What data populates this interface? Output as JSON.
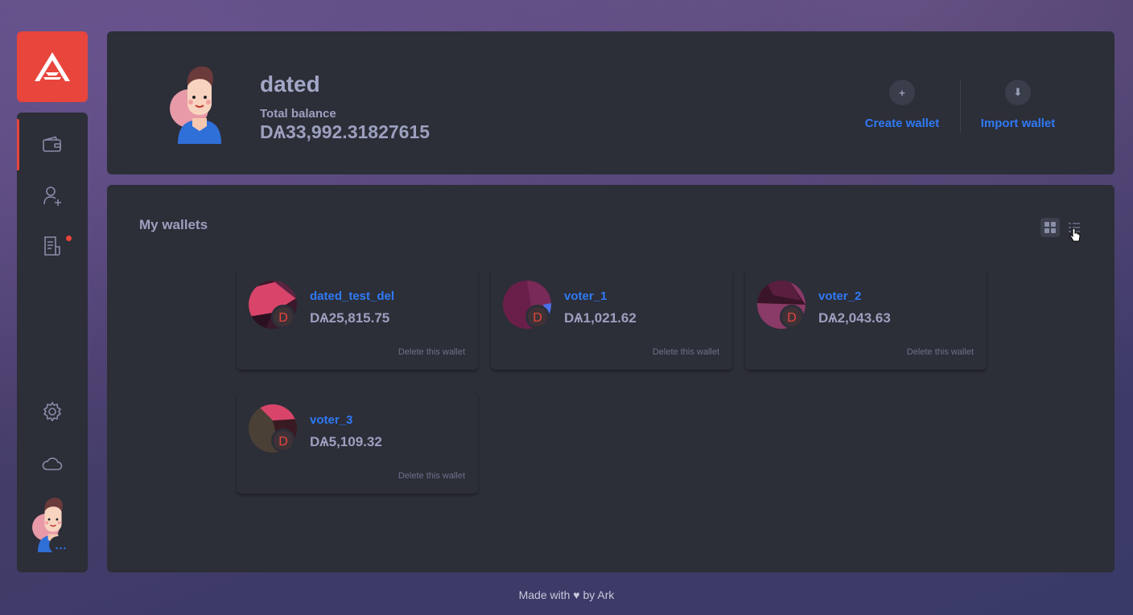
{
  "colors": {
    "accent": "#e8453c",
    "link": "#2f7af5",
    "card": "#2c2e38",
    "muted": "#9ca0be"
  },
  "sidebar": {
    "items": [
      {
        "icon": "wallet-icon",
        "active": true
      },
      {
        "icon": "add-contact-icon",
        "active": false
      },
      {
        "icon": "transactions-icon",
        "active": false,
        "notification": true
      },
      {
        "icon": "gear-icon",
        "active": false
      },
      {
        "icon": "cloud-icon",
        "active": false
      }
    ],
    "more_label": "..."
  },
  "header": {
    "profile_name": "dated",
    "balance_label": "Total balance",
    "balance_value": "DѦ33,992.31827615",
    "create_wallet": "Create wallet",
    "create_icon": "+",
    "import_wallet": "Import wallet",
    "import_icon": "⬇"
  },
  "main": {
    "title": "My wallets",
    "wallets": [
      {
        "name": "dated_test_del",
        "balance": "DѦ25,815.75",
        "delete": "Delete this wallet",
        "badge": "D"
      },
      {
        "name": "voter_1",
        "balance": "DѦ1,021.62",
        "delete": "Delete this wallet",
        "badge": "D"
      },
      {
        "name": "voter_2",
        "balance": "DѦ2,043.63",
        "delete": "Delete this wallet",
        "badge": "D"
      },
      {
        "name": "voter_3",
        "balance": "DѦ5,109.32",
        "delete": "Delete this wallet",
        "badge": "D"
      }
    ]
  },
  "footer": "Made with ♥ by Ark"
}
